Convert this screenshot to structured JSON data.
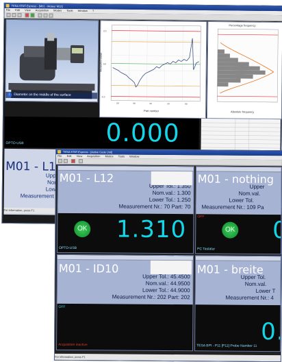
{
  "main_window": {
    "title": "TESA STAT-Express - [M01 - Moteur M12]",
    "menu": [
      "File",
      "Edit",
      "View",
      "Acquisition",
      "Modes",
      "Tools",
      "Window",
      "?"
    ],
    "image_caption": "Diameter on the middle of the surface",
    "big_value": "0.000",
    "source_label": "OPTO-USB",
    "panel_title": "M01 - L1",
    "info_lines": [
      "Uppe",
      "Nom",
      "Lowe",
      "Measurement N"
    ],
    "status_text": "For information, press F1",
    "charts": {
      "control_title": "",
      "histogram_title": "Percentage frequency",
      "x_label": "Part number",
      "y_label": "Measured value",
      "hist_x_label": "Absolute frequency"
    }
  },
  "second_window": {
    "title": "TESA STAT-Express - [Active Code Unit]",
    "status_text": "For information, press F1",
    "panels": [
      {
        "title": "M01 - L12",
        "upper": "Upper Tol.: 1.350",
        "nom": "Nom.val.: 1.300",
        "lower": "Lower Tol.: 1.250",
        "measure": "Measurement Nr.: 70 Part: 70",
        "ok": "OK",
        "value": "1.310",
        "source": "OPTO-USB"
      },
      {
        "title": "M01 - nothing",
        "upper": "Upper",
        "nom": "Nom.val.",
        "lower": "Lower Tol.",
        "measure": "Measurement Nr.: 109 Pa",
        "ok": "OK",
        "value": "0",
        "source": "PC Tastatur",
        "off_label": "OFF"
      },
      {
        "title": "M01 - ID10",
        "upper": "Upper Tol.: 45.4500",
        "nom": "Nom.val.: 44.9500",
        "lower": "Lower Tol.: 44.9000",
        "measure": "Measurement Nr.: 202 Part: 202",
        "off_label": "OFF",
        "source": "Acquisition inactive"
      },
      {
        "title": "M01 - breite",
        "upper": "Upper Tol.",
        "nom": "Nom.val.",
        "lower": "Lower T",
        "measure": "Measurement Nr.: 4",
        "value": "0.",
        "source": "TESA BPI - P11 [P11] Probe Number 11"
      }
    ]
  },
  "colors": {
    "digit_cyan": "#13d7e8",
    "ok_green": "#1fae40",
    "title_blue": "#2b56b0",
    "info_bg": "#9aa7c9",
    "off_red": "#e03a2f"
  }
}
